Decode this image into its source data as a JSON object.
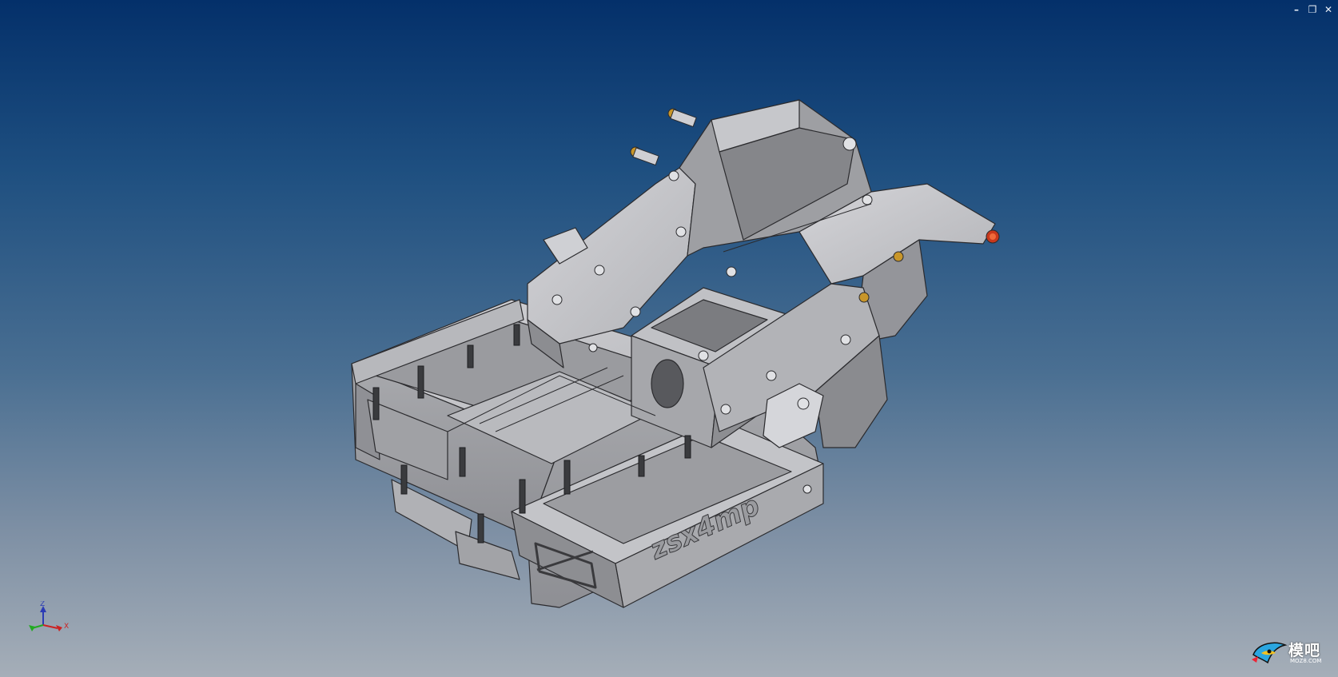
{
  "window": {
    "minimize_icon": "minimize-icon",
    "restore_icon": "restore-icon",
    "close_icon": "close-icon",
    "minimize_glyph": "–",
    "restore_glyph": "❐",
    "close_glyph": "✕"
  },
  "model": {
    "engraving": "zsx4mp",
    "colors": {
      "background_top": "#04306a",
      "background_bottom": "#a5aeb8",
      "part_light": "#c9c9cc",
      "part_mid": "#a4a5a9",
      "part_dark": "#77787d",
      "edge": "#2b2b2e",
      "brass": "#c8962a",
      "red_bushing": "#c8381c"
    }
  },
  "triad": {
    "x_label": "X",
    "z_label": "Z"
  },
  "watermark": {
    "logo_icon": "bird-logo-icon",
    "text": "模吧",
    "url": "MOZ8.COM"
  }
}
